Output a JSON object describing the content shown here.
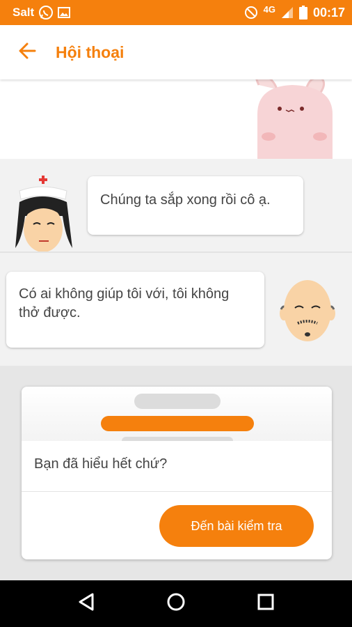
{
  "status_bar": {
    "carrier": "Salt",
    "network": "4G",
    "time": "00:17"
  },
  "app_bar": {
    "title": "Hội thoại",
    "back_icon": "arrow-left-icon"
  },
  "conversation": {
    "messages": [
      {
        "speaker": "nurse",
        "text": "Chúng ta sắp xong rồi cô ạ."
      },
      {
        "speaker": "old-man",
        "text": "Có ai không giúp tôi với, tôi không thở được."
      }
    ]
  },
  "quiz_card": {
    "question": "Bạn đã hiểu hết chứ?",
    "button_label": "Đến bài kiểm tra"
  },
  "colors": {
    "accent": "#f5800d",
    "bubble_bg": "#ffffff",
    "conversation_bg": "#f2f2f2"
  }
}
